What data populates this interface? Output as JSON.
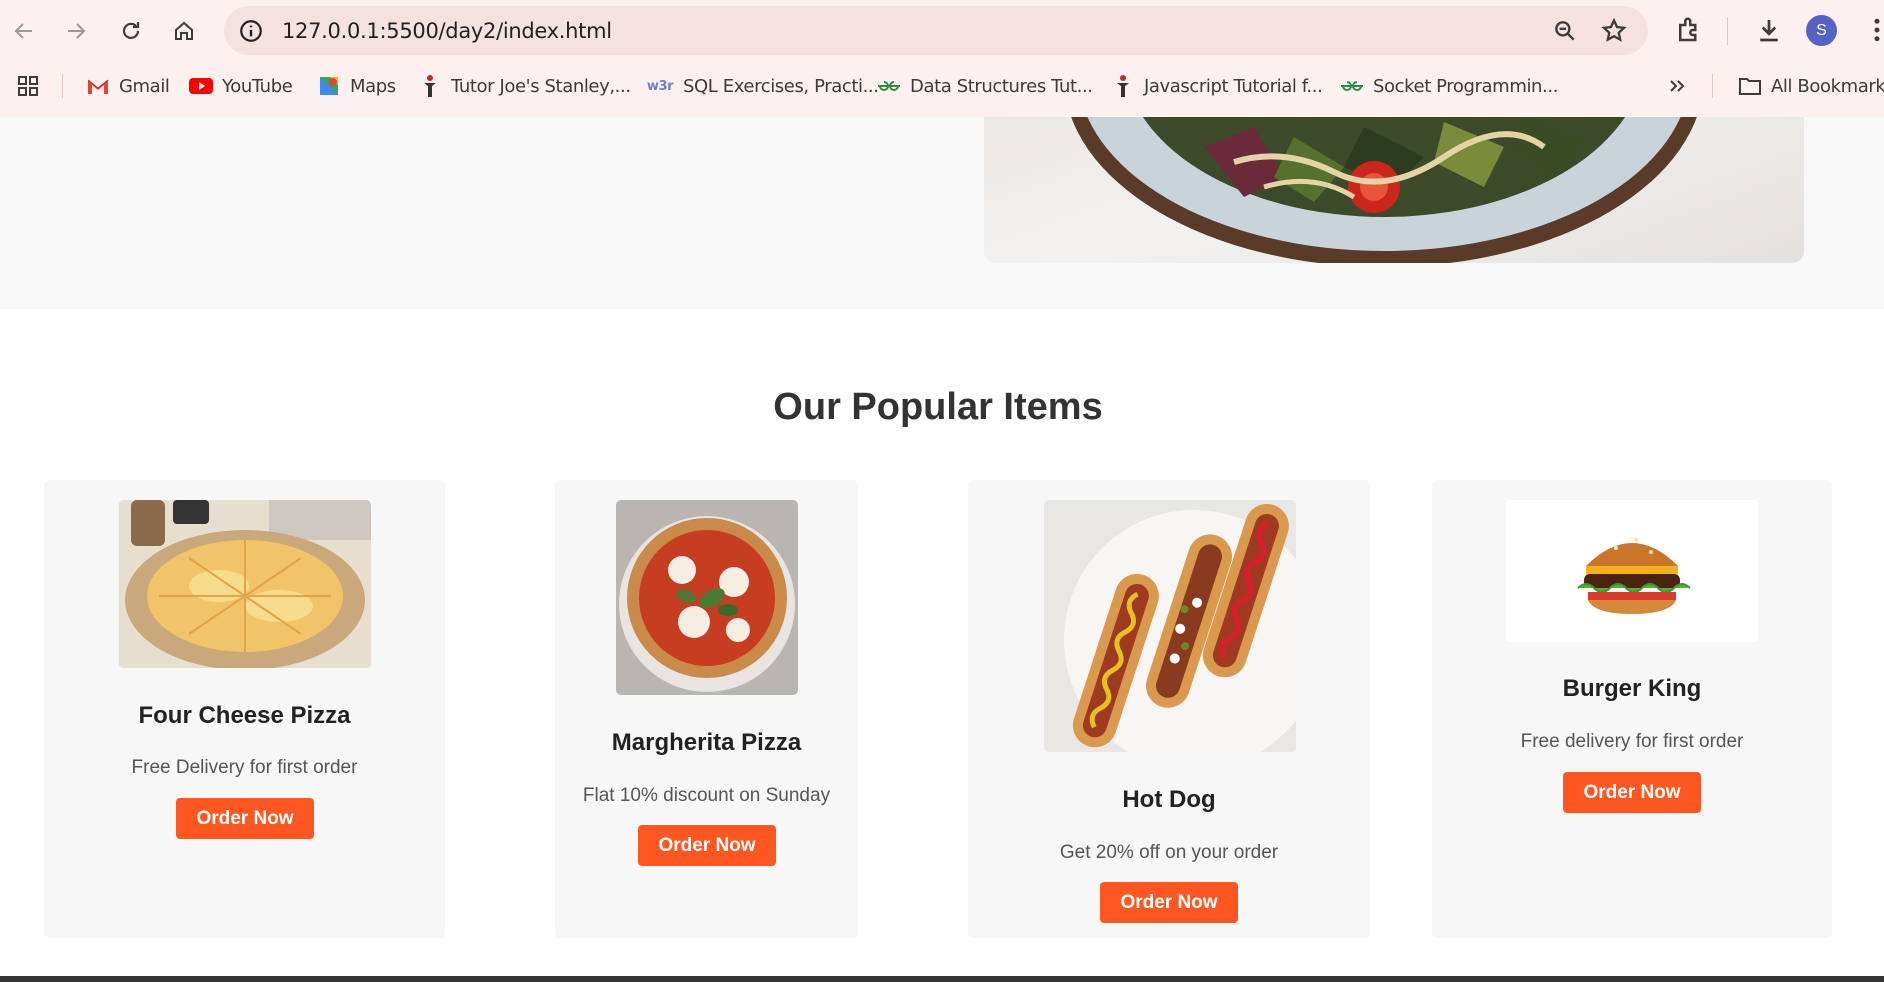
{
  "browser": {
    "url": "127.0.0.1:5500/day2/index.html",
    "avatar_letter": "S",
    "bookmarks": [
      {
        "label": "Gmail",
        "icon": "gmail-icon"
      },
      {
        "label": "YouTube",
        "icon": "youtube-icon"
      },
      {
        "label": "Maps",
        "icon": "maps-icon"
      },
      {
        "label": "Tutor Joe's Stanley,...",
        "icon": "tutorjoes-icon"
      },
      {
        "label": "SQL Exercises, Practi...",
        "icon": "w3r-icon"
      },
      {
        "label": "Data Structures Tut...",
        "icon": "gfg-icon"
      },
      {
        "label": "Javascript Tutorial f...",
        "icon": "tutorjoes-icon"
      },
      {
        "label": "Socket Programmin...",
        "icon": "gfg-icon"
      }
    ],
    "all_bookmarks": "All Bookmarks",
    "w3r_text": "w3r"
  },
  "page": {
    "section_title": "Our Popular Items",
    "items": [
      {
        "name": "Four Cheese Pizza",
        "desc": "Free Delivery for first order",
        "button": "Order Now"
      },
      {
        "name": "Margherita Pizza",
        "desc": "Flat 10% discount on Sunday",
        "button": "Order Now"
      },
      {
        "name": "Hot Dog",
        "desc": "Get 20% off on your order",
        "button": "Order Now"
      },
      {
        "name": "Burger King",
        "desc": "Free delivery for first order",
        "button": "Order Now"
      }
    ]
  },
  "colors": {
    "accent": "#ff5722",
    "avatar": "#5763c4"
  }
}
